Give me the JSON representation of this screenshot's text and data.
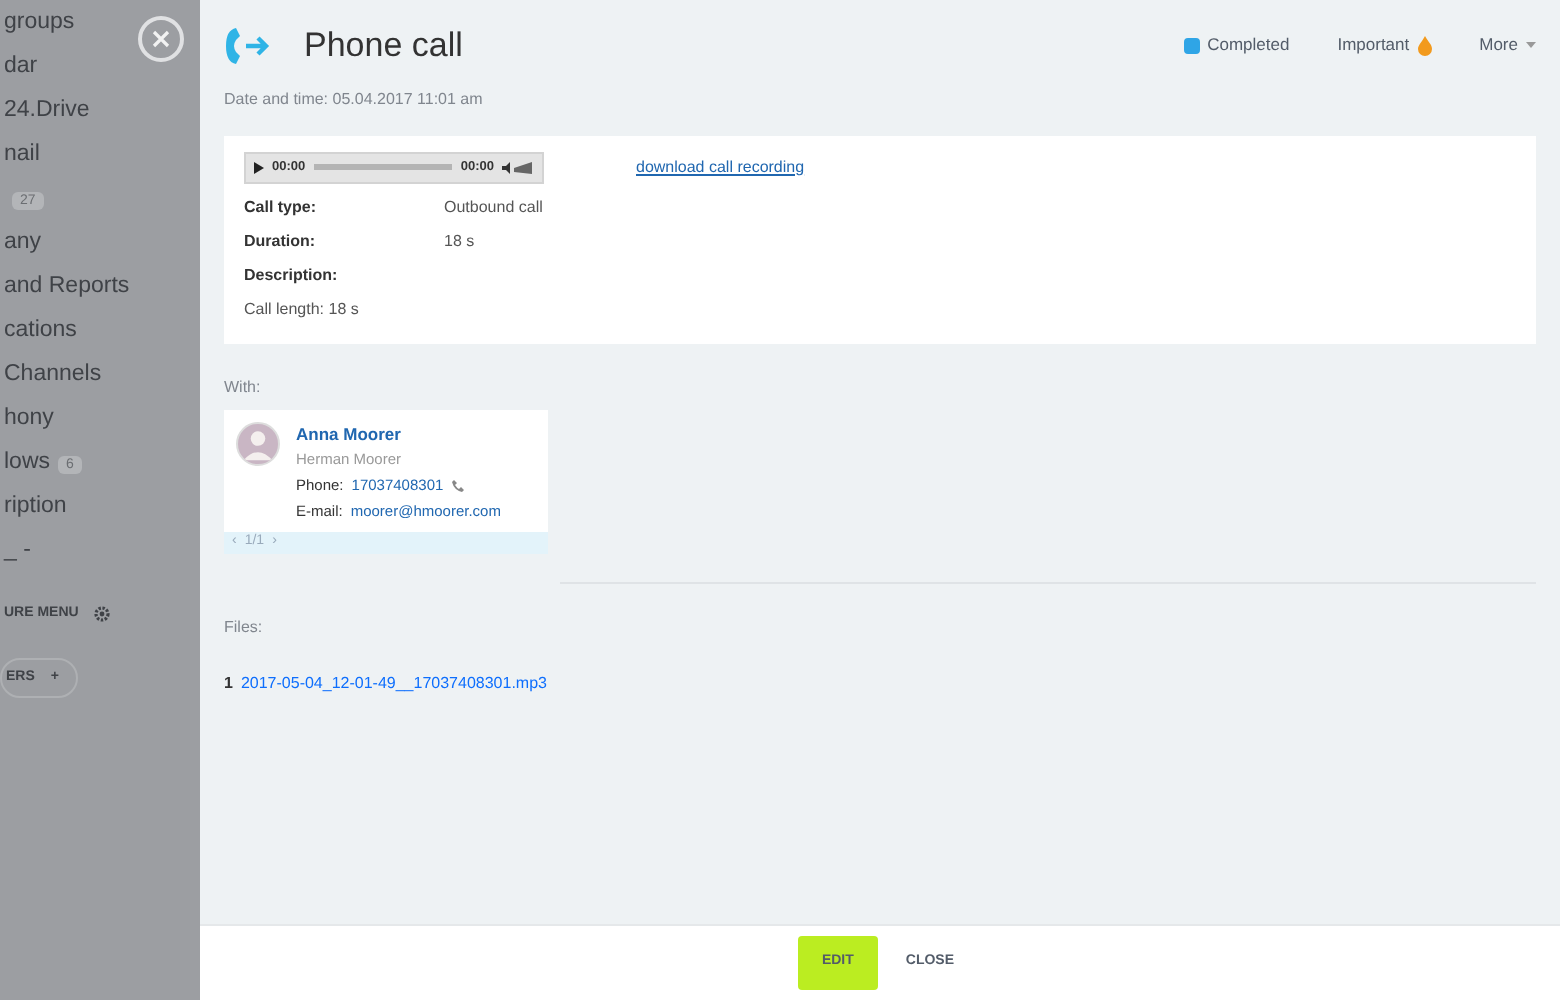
{
  "sidebar": {
    "items": [
      {
        "label": "groups"
      },
      {
        "label": "dar"
      },
      {
        "label": "24.Drive"
      },
      {
        "label": "nail"
      },
      {
        "badge": "27"
      },
      {
        "label": "any"
      },
      {
        "label": "and Reports"
      },
      {
        "label": "cations"
      },
      {
        "label": "Channels"
      },
      {
        "label": "hony"
      },
      {
        "label": "lows",
        "badge": "6"
      },
      {
        "label": "ription"
      },
      {
        "label": "_ -"
      }
    ],
    "configure": "URE MENU",
    "invite": "ERS",
    "invite_icon": "+"
  },
  "header": {
    "title": "Phone call",
    "completed": {
      "label": "Completed",
      "checked": true
    },
    "important": "Important",
    "more": "More",
    "date_label": "Date and time:",
    "date_value": "05.04.2017 11:01 am"
  },
  "player": {
    "time_start": "00:00",
    "time_end": "00:00"
  },
  "download_link": "download call recording",
  "fields": [
    {
      "label": "Call type:",
      "value": "Outbound call"
    },
    {
      "label": "Duration:",
      "value": "18 s"
    },
    {
      "label": "Description:"
    }
  ],
  "call_length": "Call length: 18 s",
  "with_label": "With:",
  "contact": {
    "name": "Anna Moorer",
    "company": "Herman Moorer",
    "phone_label": "Phone:",
    "phone": "17037408301",
    "email_label": "E-mail:",
    "email": "moorer@hmoorer.com"
  },
  "pager": {
    "prev": "‹",
    "text": "1/1",
    "next": "›"
  },
  "files_label": "Files:",
  "files": [
    {
      "number": "1",
      "name": "2017-05-04_12-01-49__17037408301.mp3"
    }
  ],
  "buttons": [
    {
      "label": "EDIT",
      "kind": "primary"
    },
    {
      "label": "CLOSE",
      "kind": "link"
    }
  ]
}
